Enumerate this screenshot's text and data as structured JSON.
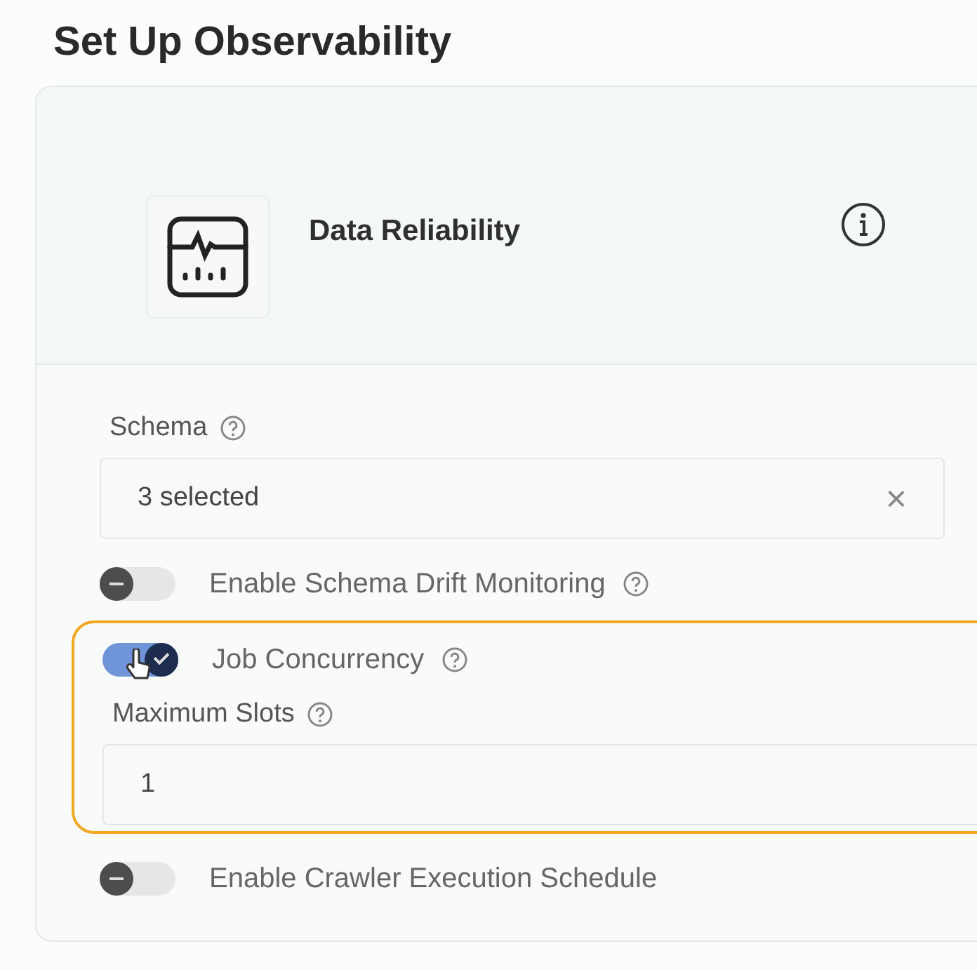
{
  "title": "Set Up Observability",
  "card": {
    "name": "Data Reliability"
  },
  "schema": {
    "label": "Schema",
    "value": "3 selected",
    "clear": "×"
  },
  "settings": [
    {
      "kind": "toggle",
      "label": "Enable Schema Drift Monitoring",
      "on": false,
      "help": true
    },
    {
      "kind": "group",
      "highlighted": true,
      "items": [
        {
          "kind": "toggle",
          "label": "Job Concurrency",
          "on": true
        },
        {
          "kind": "field",
          "label": "Maximum Slots",
          "value": "1"
        }
      ]
    },
    {
      "kind": "toggle",
      "label": "Enable Crawler Execution Schedule",
      "on": false,
      "help": false
    }
  ]
}
